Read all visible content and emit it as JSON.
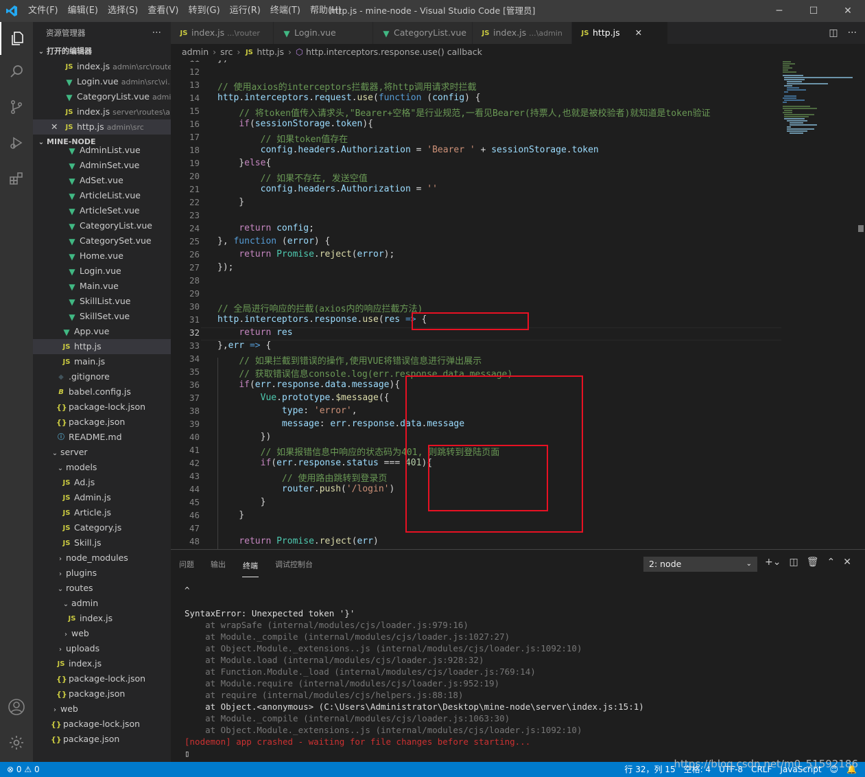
{
  "window": {
    "title": "http.js - mine-node - Visual Studio Code [管理员]",
    "menu": [
      "文件(F)",
      "编辑(E)",
      "选择(S)",
      "查看(V)",
      "转到(G)",
      "运行(R)",
      "终端(T)",
      "帮助(H)"
    ]
  },
  "explorer": {
    "title": "资源管理器",
    "open_editors_label": "打开的编辑器",
    "project_label": "MINE-NODE",
    "open_editors": [
      {
        "name": "index.js",
        "desc": "admin\\src\\router",
        "icon": "JS"
      },
      {
        "name": "Login.vue",
        "desc": "admin\\src\\vi...",
        "icon": "V"
      },
      {
        "name": "CategoryList.vue",
        "desc": "admi...",
        "icon": "V"
      },
      {
        "name": "index.js",
        "desc": "server\\routes\\a...",
        "icon": "JS"
      },
      {
        "name": "http.js",
        "desc": "admin\\src",
        "icon": "JS"
      }
    ],
    "tree": [
      {
        "name": "AdminList.vue",
        "icon": "V",
        "indent": 2
      },
      {
        "name": "AdminSet.vue",
        "icon": "V",
        "indent": 2
      },
      {
        "name": "AdSet.vue",
        "icon": "V",
        "indent": 2
      },
      {
        "name": "ArticleList.vue",
        "icon": "V",
        "indent": 2
      },
      {
        "name": "ArticleSet.vue",
        "icon": "V",
        "indent": 2
      },
      {
        "name": "CategoryList.vue",
        "icon": "V",
        "indent": 2
      },
      {
        "name": "CategorySet.vue",
        "icon": "V",
        "indent": 2
      },
      {
        "name": "Home.vue",
        "icon": "V",
        "indent": 2
      },
      {
        "name": "Login.vue",
        "icon": "V",
        "indent": 2
      },
      {
        "name": "Main.vue",
        "icon": "V",
        "indent": 2
      },
      {
        "name": "SkillList.vue",
        "icon": "V",
        "indent": 2
      },
      {
        "name": "SkillSet.vue",
        "icon": "V",
        "indent": 2
      },
      {
        "name": "App.vue",
        "icon": "V",
        "indent": 1
      },
      {
        "name": "http.js",
        "icon": "JS",
        "indent": 1,
        "selected": true
      },
      {
        "name": "main.js",
        "icon": "JS",
        "indent": 1
      },
      {
        "name": ".gitignore",
        "icon": "git",
        "indent": 0
      },
      {
        "name": "babel.config.js",
        "icon": "babel",
        "indent": 0
      },
      {
        "name": "package-lock.json",
        "icon": "{}",
        "indent": 0
      },
      {
        "name": "package.json",
        "icon": "{}",
        "indent": 0
      },
      {
        "name": "README.md",
        "icon": "info",
        "indent": 0
      },
      {
        "name": "server",
        "icon": "folder-open",
        "indent": -1
      },
      {
        "name": "models",
        "icon": "folder-open",
        "indent": 0
      },
      {
        "name": "Ad.js",
        "icon": "JS",
        "indent": 1
      },
      {
        "name": "Admin.js",
        "icon": "JS",
        "indent": 1
      },
      {
        "name": "Article.js",
        "icon": "JS",
        "indent": 1
      },
      {
        "name": "Category.js",
        "icon": "JS",
        "indent": 1
      },
      {
        "name": "Skill.js",
        "icon": "JS",
        "indent": 1
      },
      {
        "name": "node_modules",
        "icon": "folder",
        "indent": 0
      },
      {
        "name": "plugins",
        "icon": "folder",
        "indent": 0
      },
      {
        "name": "routes",
        "icon": "folder-open",
        "indent": 0
      },
      {
        "name": "admin",
        "icon": "folder-open",
        "indent": 1
      },
      {
        "name": "index.js",
        "icon": "JS",
        "indent": 2
      },
      {
        "name": "web",
        "icon": "folder",
        "indent": 1
      },
      {
        "name": "uploads",
        "icon": "folder",
        "indent": 0
      },
      {
        "name": "index.js",
        "icon": "JS",
        "indent": 0
      },
      {
        "name": "package-lock.json",
        "icon": "{}",
        "indent": 0
      },
      {
        "name": "package.json",
        "icon": "{}",
        "indent": 0
      },
      {
        "name": "web",
        "icon": "folder",
        "indent": -1
      },
      {
        "name": "package-lock.json",
        "icon": "{}",
        "indent": -1
      },
      {
        "name": "package.json",
        "icon": "{}",
        "indent": -1
      }
    ]
  },
  "tabs": [
    {
      "name": "index.js",
      "desc": "...\\router",
      "icon": "JS"
    },
    {
      "name": "Login.vue",
      "desc": "",
      "icon": "V"
    },
    {
      "name": "CategoryList.vue",
      "desc": "",
      "icon": "V"
    },
    {
      "name": "index.js",
      "desc": "...\\admin",
      "icon": "JS"
    },
    {
      "name": "http.js",
      "desc": "",
      "icon": "JS",
      "active": true
    }
  ],
  "breadcrumb": [
    "admin",
    "src",
    "http.js",
    "http.interceptors.response.use() callback"
  ],
  "editor": {
    "current_line": 32,
    "lines": [
      {
        "n": 11,
        "tokens": [
          [
            "",
            "})"
          ]
        ]
      },
      {
        "n": 12,
        "tokens": []
      },
      {
        "n": 13,
        "tokens": [
          [
            "c",
            "// 使用axios的interceptors拦截器,将http调用请求时拦截"
          ]
        ]
      },
      {
        "n": 14,
        "tokens": [
          [
            "v",
            "http"
          ],
          [
            "",
            "."
          ],
          [
            "v",
            "interceptors"
          ],
          [
            "",
            "."
          ],
          [
            "v",
            "request"
          ],
          [
            "",
            "."
          ],
          [
            "f",
            "use"
          ],
          [
            "",
            "("
          ],
          [
            "k",
            "function"
          ],
          [
            "",
            " ("
          ],
          [
            "v",
            "config"
          ],
          [
            "",
            ") {"
          ]
        ]
      },
      {
        "n": 15,
        "tokens": [
          [
            "",
            "    "
          ],
          [
            "c",
            "// 将token值传入请求头,\"Bearer+空格\"是行业规范,一看见Bearer(持票人,也就是被校验者)就知道是token验证"
          ]
        ]
      },
      {
        "n": 16,
        "tokens": [
          [
            "",
            "    "
          ],
          [
            "kw",
            "if"
          ],
          [
            "",
            "("
          ],
          [
            "v",
            "sessionStorage"
          ],
          [
            "",
            "."
          ],
          [
            "v",
            "token"
          ],
          [
            "",
            "){"
          ]
        ]
      },
      {
        "n": 17,
        "tokens": [
          [
            "",
            "        "
          ],
          [
            "c",
            "// 如果token值存在"
          ]
        ]
      },
      {
        "n": 18,
        "tokens": [
          [
            "",
            "        "
          ],
          [
            "v",
            "config"
          ],
          [
            "",
            "."
          ],
          [
            "v",
            "headers"
          ],
          [
            "",
            "."
          ],
          [
            "v",
            "Authorization"
          ],
          [
            "",
            " = "
          ],
          [
            "s",
            "'Bearer '"
          ],
          [
            "",
            " + "
          ],
          [
            "v",
            "sessionStorage"
          ],
          [
            "",
            "."
          ],
          [
            "v",
            "token"
          ]
        ]
      },
      {
        "n": 19,
        "tokens": [
          [
            "",
            "    }"
          ],
          [
            "kw",
            "else"
          ],
          [
            "",
            "{"
          ]
        ]
      },
      {
        "n": 20,
        "tokens": [
          [
            "",
            "        "
          ],
          [
            "c",
            "// 如果不存在, 发送空值"
          ]
        ]
      },
      {
        "n": 21,
        "tokens": [
          [
            "",
            "        "
          ],
          [
            "v",
            "config"
          ],
          [
            "",
            "."
          ],
          [
            "v",
            "headers"
          ],
          [
            "",
            "."
          ],
          [
            "v",
            "Authorization"
          ],
          [
            "",
            " = "
          ],
          [
            "s",
            "''"
          ]
        ]
      },
      {
        "n": 22,
        "tokens": [
          [
            "",
            "    }"
          ]
        ]
      },
      {
        "n": 23,
        "tokens": []
      },
      {
        "n": 24,
        "tokens": [
          [
            "",
            "    "
          ],
          [
            "kw",
            "return"
          ],
          [
            "",
            " "
          ],
          [
            "v",
            "config"
          ],
          [
            "",
            ";"
          ]
        ]
      },
      {
        "n": 25,
        "tokens": [
          [
            "",
            "}, "
          ],
          [
            "k",
            "function"
          ],
          [
            "",
            " ("
          ],
          [
            "v",
            "error"
          ],
          [
            "",
            ") {"
          ]
        ]
      },
      {
        "n": 26,
        "tokens": [
          [
            "",
            "    "
          ],
          [
            "kw",
            "return"
          ],
          [
            "",
            " "
          ],
          [
            "t",
            "Promise"
          ],
          [
            "",
            "."
          ],
          [
            "f",
            "reject"
          ],
          [
            "",
            "("
          ],
          [
            "v",
            "error"
          ],
          [
            "",
            ");"
          ]
        ]
      },
      {
        "n": 27,
        "tokens": [
          [
            "",
            "});"
          ]
        ]
      },
      {
        "n": 28,
        "tokens": []
      },
      {
        "n": 29,
        "tokens": []
      },
      {
        "n": 30,
        "tokens": [
          [
            "c",
            "// 全局进行响应的拦截(axios内的响应拦截方法)"
          ]
        ]
      },
      {
        "n": 31,
        "tokens": [
          [
            "v",
            "http"
          ],
          [
            "",
            "."
          ],
          [
            "v",
            "interceptors"
          ],
          [
            "",
            "."
          ],
          [
            "v",
            "response"
          ],
          [
            "",
            "."
          ],
          [
            "f",
            "use"
          ],
          [
            "",
            "("
          ],
          [
            "v",
            "res"
          ],
          [
            "",
            " "
          ],
          [
            "k",
            "=>"
          ],
          [
            "",
            " {"
          ]
        ]
      },
      {
        "n": 32,
        "tokens": [
          [
            "",
            "    "
          ],
          [
            "kw",
            "return"
          ],
          [
            "",
            " "
          ],
          [
            "v",
            "res"
          ]
        ]
      },
      {
        "n": 33,
        "tokens": [
          [
            "",
            "},"
          ],
          [
            "v",
            "err"
          ],
          [
            "",
            " "
          ],
          [
            "k",
            "=>"
          ],
          [
            "",
            " {"
          ]
        ]
      },
      {
        "n": 34,
        "tokens": [
          [
            "",
            "    "
          ],
          [
            "c",
            "// 如果拦截到错误的操作,使用VUE将错误信息进行弹出展示"
          ]
        ]
      },
      {
        "n": 35,
        "tokens": [
          [
            "",
            "    "
          ],
          [
            "c",
            "// 获取错误信息console.log(err.response.data.message)"
          ]
        ]
      },
      {
        "n": 36,
        "tokens": [
          [
            "",
            "    "
          ],
          [
            "kw",
            "if"
          ],
          [
            "",
            "("
          ],
          [
            "v",
            "err"
          ],
          [
            "",
            "."
          ],
          [
            "v",
            "response"
          ],
          [
            "",
            "."
          ],
          [
            "v",
            "data"
          ],
          [
            "",
            "."
          ],
          [
            "v",
            "message"
          ],
          [
            "",
            "){"
          ]
        ]
      },
      {
        "n": 37,
        "tokens": [
          [
            "",
            "        "
          ],
          [
            "t",
            "Vue"
          ],
          [
            "",
            "."
          ],
          [
            "v",
            "prototype"
          ],
          [
            "",
            "."
          ],
          [
            "f",
            "$message"
          ],
          [
            "",
            "({"
          ]
        ]
      },
      {
        "n": 38,
        "tokens": [
          [
            "",
            "            "
          ],
          [
            "v",
            "type"
          ],
          [
            "",
            ": "
          ],
          [
            "s",
            "'error'"
          ],
          [
            "",
            ","
          ]
        ]
      },
      {
        "n": 39,
        "tokens": [
          [
            "",
            "            "
          ],
          [
            "v",
            "message"
          ],
          [
            "",
            ": "
          ],
          [
            "v",
            "err"
          ],
          [
            "",
            "."
          ],
          [
            "v",
            "response"
          ],
          [
            "",
            "."
          ],
          [
            "v",
            "data"
          ],
          [
            "",
            "."
          ],
          [
            "v",
            "message"
          ]
        ]
      },
      {
        "n": 40,
        "tokens": [
          [
            "",
            "        })"
          ]
        ]
      },
      {
        "n": 41,
        "tokens": [
          [
            "",
            "        "
          ],
          [
            "c",
            "// 如果报错信息中响应的状态码为401, 则跳转到登陆页面"
          ]
        ]
      },
      {
        "n": 42,
        "tokens": [
          [
            "",
            "        "
          ],
          [
            "kw",
            "if"
          ],
          [
            "",
            "("
          ],
          [
            "v",
            "err"
          ],
          [
            "",
            "."
          ],
          [
            "v",
            "response"
          ],
          [
            "",
            "."
          ],
          [
            "v",
            "status"
          ],
          [
            "",
            " === "
          ],
          [
            "n",
            "401"
          ],
          [
            "",
            "){"
          ]
        ]
      },
      {
        "n": 43,
        "tokens": [
          [
            "",
            "            "
          ],
          [
            "c",
            "// 使用路由跳转到登录页"
          ]
        ]
      },
      {
        "n": 44,
        "tokens": [
          [
            "",
            "            "
          ],
          [
            "v",
            "router"
          ],
          [
            "",
            "."
          ],
          [
            "f",
            "push"
          ],
          [
            "",
            "("
          ],
          [
            "s",
            "'/login'"
          ],
          [
            "",
            ")"
          ]
        ]
      },
      {
        "n": 45,
        "tokens": [
          [
            "",
            "        }"
          ]
        ]
      },
      {
        "n": 46,
        "tokens": [
          [
            "",
            "    }"
          ]
        ]
      },
      {
        "n": 47,
        "tokens": []
      },
      {
        "n": 48,
        "tokens": [
          [
            "",
            "    "
          ],
          [
            "kw",
            "return"
          ],
          [
            "",
            " "
          ],
          [
            "t",
            "Promise"
          ],
          [
            "",
            "."
          ],
          [
            "f",
            "reject"
          ],
          [
            "",
            "("
          ],
          [
            "v",
            "err"
          ],
          [
            "",
            ")"
          ]
        ]
      }
    ]
  },
  "panel": {
    "tabs": [
      "问题",
      "输出",
      "终端",
      "调试控制台"
    ],
    "active_tab": "终端",
    "terminal_select": "2: node",
    "terminal_lines": [
      {
        "c": "w",
        "t": "^"
      },
      {
        "c": "w",
        "t": ""
      },
      {
        "c": "w",
        "t": "SyntaxError: Unexpected token '}'"
      },
      {
        "c": "g",
        "t": "    at wrapSafe (internal/modules/cjs/loader.js:979:16)"
      },
      {
        "c": "g",
        "t": "    at Module._compile (internal/modules/cjs/loader.js:1027:27)"
      },
      {
        "c": "g",
        "t": "    at Object.Module._extensions..js (internal/modules/cjs/loader.js:1092:10)"
      },
      {
        "c": "g",
        "t": "    at Module.load (internal/modules/cjs/loader.js:928:32)"
      },
      {
        "c": "g",
        "t": "    at Function.Module._load (internal/modules/cjs/loader.js:769:14)"
      },
      {
        "c": "g",
        "t": "    at Module.require (internal/modules/cjs/loader.js:952:19)"
      },
      {
        "c": "g",
        "t": "    at require (internal/modules/cjs/helpers.js:88:18)"
      },
      {
        "c": "w",
        "t": "    at Object.<anonymous> (C:\\Users\\Administrator\\Desktop\\mine-node\\server\\index.js:15:1)"
      },
      {
        "c": "g",
        "t": "    at Module._compile (internal/modules/cjs/loader.js:1063:30)"
      },
      {
        "c": "g",
        "t": "    at Object.Module._extensions..js (internal/modules/cjs/loader.js:1092:10)"
      },
      {
        "c": "r",
        "t": "[nodemon] app crashed - waiting for file changes before starting..."
      },
      {
        "c": "w",
        "t": "▯"
      }
    ]
  },
  "status": {
    "errors": "0",
    "warnings": "0",
    "position": "行 32，列 15",
    "spaces": "空格: 4",
    "encoding": "UTF-8",
    "eol": "CRLF",
    "language": "JavaScript",
    "watermark": "https://blog.csdn.net/m0_51592186"
  }
}
